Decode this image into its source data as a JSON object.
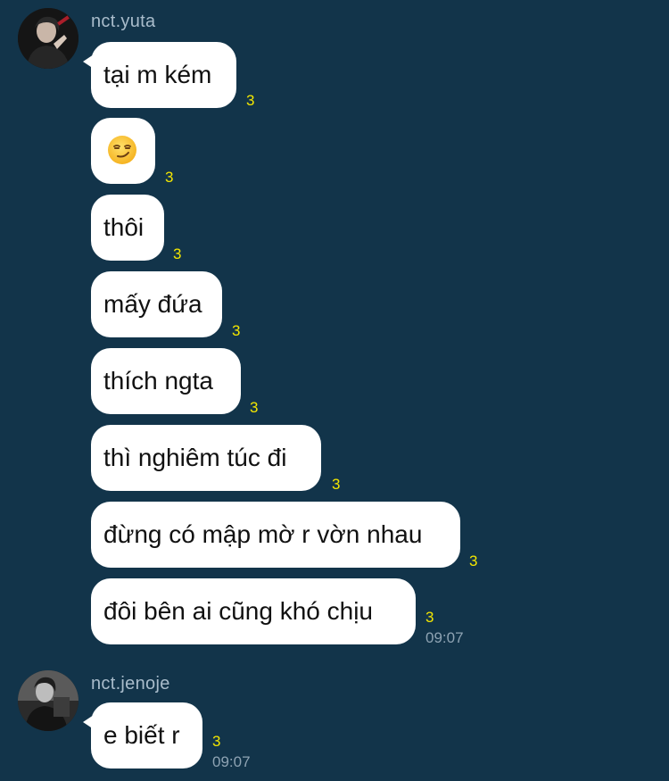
{
  "conversation": [
    {
      "sender": "nct.yuta",
      "avatar_icon": "profile-photo-avatar",
      "messages": [
        {
          "text": "tại m kém",
          "read_count": "3"
        },
        {
          "text": "",
          "emoji": "smirking-face",
          "read_count": "3"
        },
        {
          "text": "thôi",
          "read_count": "3"
        },
        {
          "text": "mấy đứa",
          "read_count": "3"
        },
        {
          "text": "thích ngta",
          "read_count": "3"
        },
        {
          "text": "thì nghiêm túc đi",
          "read_count": "3"
        },
        {
          "text": "đừng có mập mờ r vờn nhau",
          "read_count": "3"
        },
        {
          "text": "đôi bên ai cũng khó chịu",
          "read_count": "3",
          "time": "09:07"
        }
      ]
    },
    {
      "sender": "nct.jenoje",
      "avatar_icon": "profile-photo-avatar",
      "messages": [
        {
          "text": "e biết r",
          "read_count": "3",
          "time": "09:07"
        }
      ]
    }
  ],
  "colors": {
    "background": "#12344a",
    "bubble": "#ffffff",
    "read_count": "#f3e600",
    "timestamp": "#8ea3b3",
    "sender_name": "#a9bccb"
  }
}
